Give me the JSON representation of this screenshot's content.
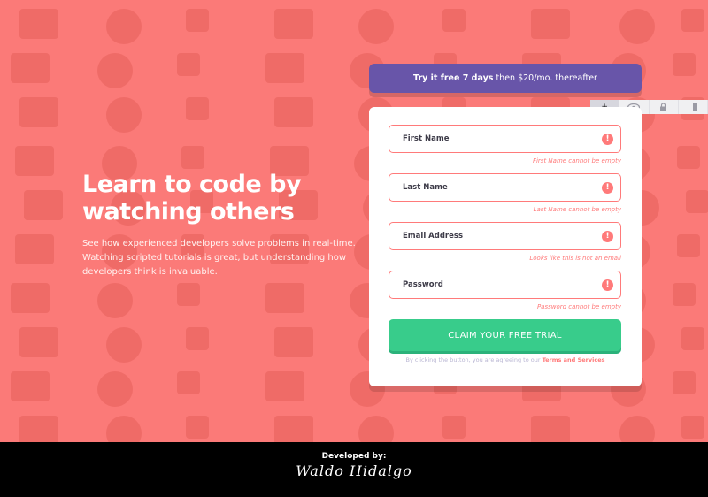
{
  "hero": {
    "title_line1": "Learn to code by",
    "title_line2": "watching others",
    "description": "See how experienced developers solve problems in real-time. Watching scripted tutorials is great, but understanding how developers think is invaluable."
  },
  "promo": {
    "bold": "Try it free 7 days",
    "rest": " then $20/mo. thereafter"
  },
  "toolbar": {
    "items": [
      "+",
      "eye",
      "lock",
      "panel"
    ]
  },
  "form": {
    "fields": [
      {
        "placeholder": "First Name",
        "error": "First Name cannot be empty"
      },
      {
        "placeholder": "Last Name",
        "error": "Last Name cannot be empty"
      },
      {
        "placeholder": "Email Address",
        "error": "Looks like this is not an email"
      },
      {
        "placeholder": "Password",
        "error": "Password cannot be empty"
      }
    ],
    "error_icon": "!",
    "submit_label": "CLAIM YOUR FREE TRIAL",
    "terms_prefix": "By clicking the button, you are agreeing to our ",
    "terms_link": "Terms and Services"
  },
  "footer": {
    "developed_by": "Developed by:",
    "signature": "Waldo Hidalgo"
  },
  "colors": {
    "background": "#fb7a78",
    "promo": "#6855a9",
    "accent_green": "#38cc8b",
    "error": "#ff7a7a"
  }
}
